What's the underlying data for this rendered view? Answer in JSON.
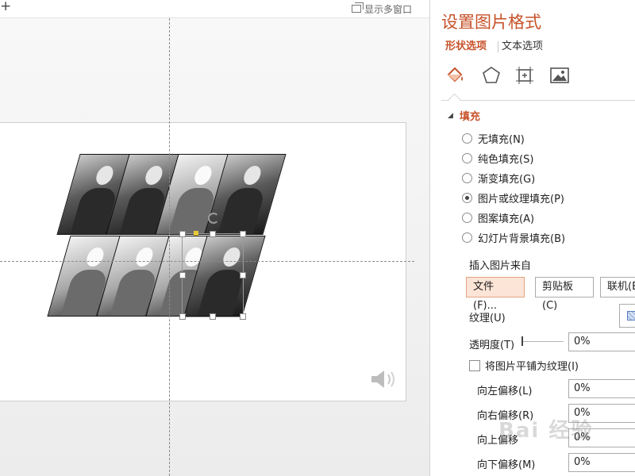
{
  "top_bar": {
    "add_label": "+",
    "multi_window_label": "显示多窗口"
  },
  "pane": {
    "title": "设置图片格式",
    "tabs": [
      {
        "label": "形状选项",
        "active": true
      },
      {
        "label": "文本选项",
        "active": false
      }
    ],
    "category_icons": [
      "fill-line-icon",
      "effects-icon",
      "size-properties-icon",
      "picture-icon"
    ],
    "fill_section": {
      "title": "填充",
      "expanded": true,
      "options": [
        {
          "label": "无填充(N)",
          "selected": false
        },
        {
          "label": "纯色填充(S)",
          "selected": false
        },
        {
          "label": "渐变填充(G)",
          "selected": false
        },
        {
          "label": "图片或纹理填充(P)",
          "selected": true
        },
        {
          "label": "图案填充(A)",
          "selected": false
        },
        {
          "label": "幻灯片背景填充(B)",
          "selected": false
        }
      ]
    },
    "insert_from": {
      "label": "插入图片来自",
      "buttons": {
        "file": "文件(F)...",
        "clipboard": "剪贴板(C)",
        "online": "联机(E"
      }
    },
    "texture_label": "纹理(U)",
    "transparency": {
      "label": "透明度(T)",
      "value": "0%",
      "level": 0
    },
    "tile_as_texture": {
      "label": "将图片平铺为纹理(I)",
      "checked": false
    },
    "offsets": {
      "left": {
        "label": "向左偏移(L)",
        "value": "0%"
      },
      "right": {
        "label": "向右偏移(R)",
        "value": "0%"
      },
      "up": {
        "label": "向上偏移",
        "value": "0%"
      },
      "down": {
        "label": "向下偏移(M)",
        "value": "0%"
      }
    }
  },
  "colors": {
    "accent": "#c7522a",
    "selected_button_bg": "#fce4d6"
  }
}
